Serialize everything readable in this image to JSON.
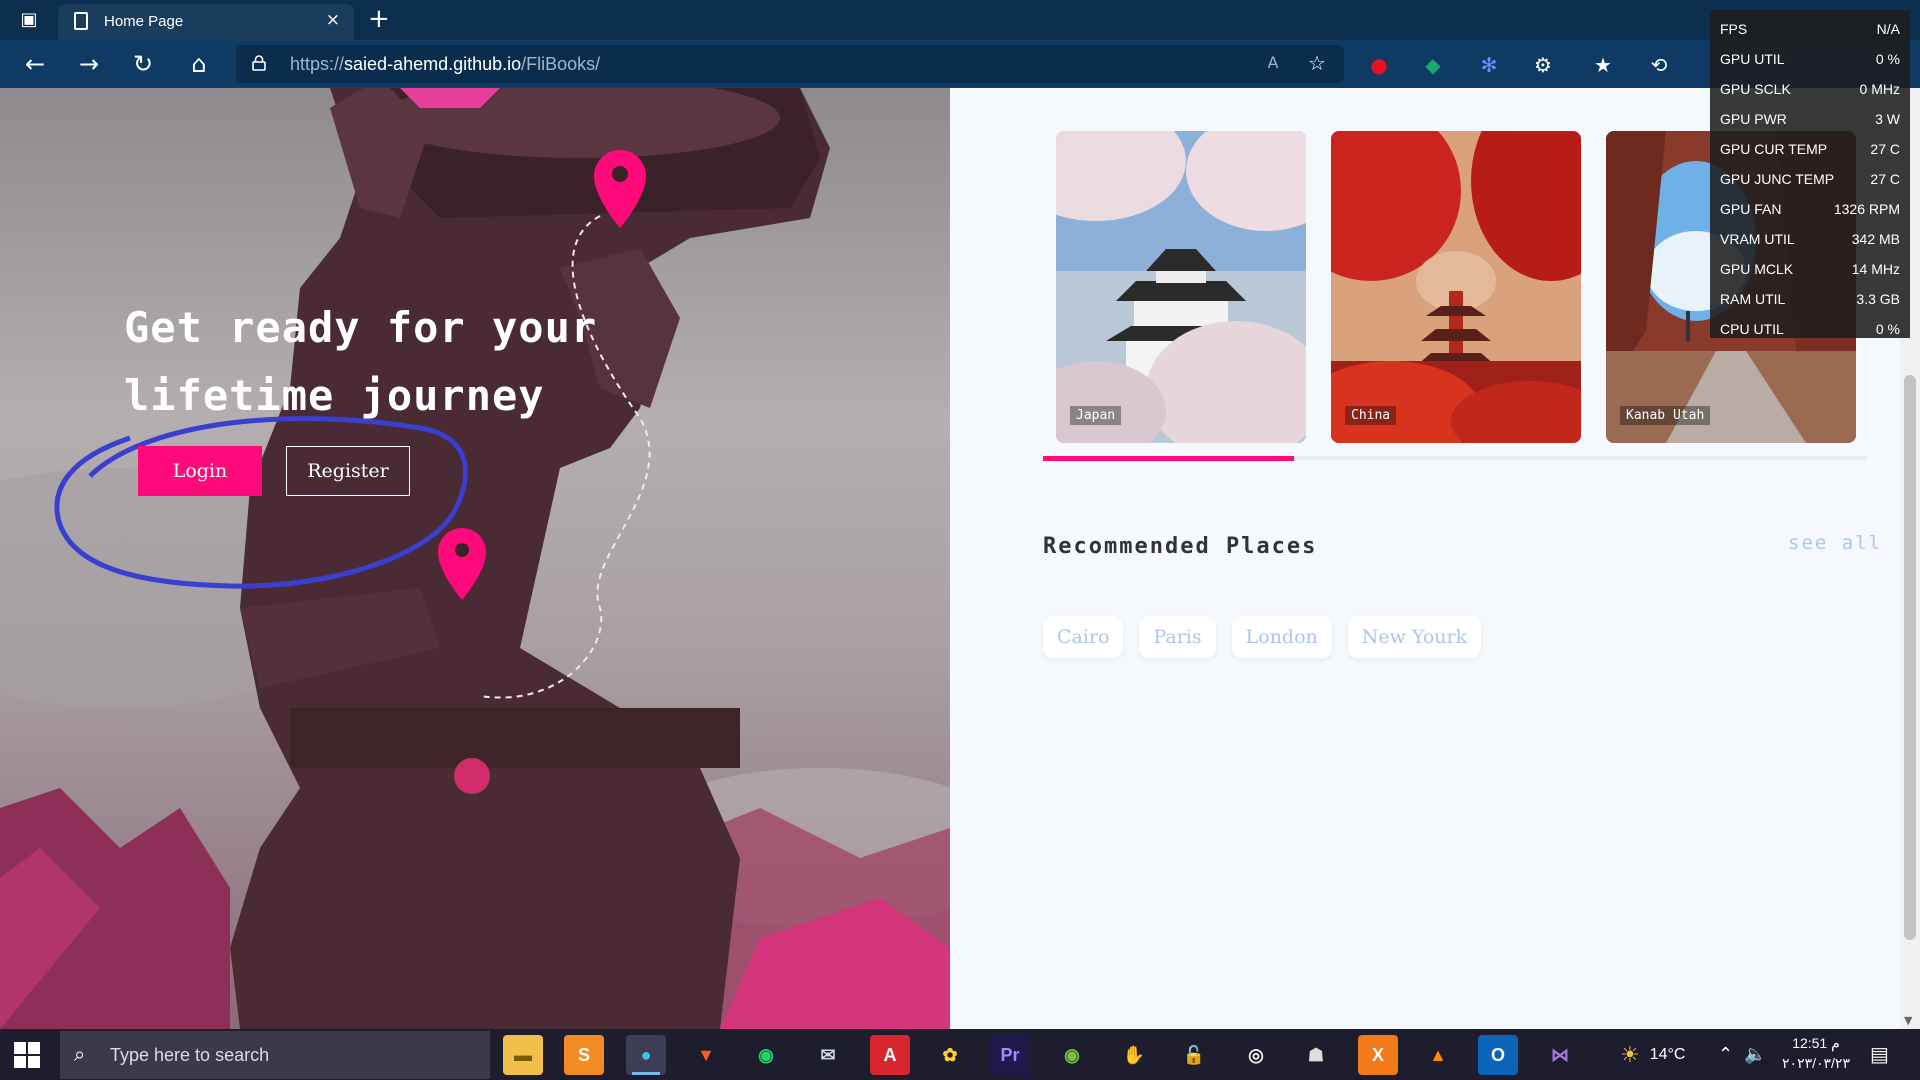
{
  "browser": {
    "tab_title": "Home Page",
    "close_tab": "×",
    "new_tab": "+",
    "url_prefix": "https://",
    "url_host": "saied-ahemd.github.io",
    "url_path": "/FliBooks/"
  },
  "gpu_overlay": {
    "rows": [
      {
        "label": "FPS",
        "value": "N/A"
      },
      {
        "label": "GPU UTIL",
        "value": "0 %"
      },
      {
        "label": "GPU SCLK",
        "value": "0 MHz"
      },
      {
        "label": "GPU PWR",
        "value": "3 W"
      },
      {
        "label": "GPU CUR TEMP",
        "value": "27 C"
      },
      {
        "label": "GPU JUNC TEMP",
        "value": "27 C"
      },
      {
        "label": "GPU FAN",
        "value": "1326 RPM"
      },
      {
        "label": "VRAM UTIL",
        "value": "342 MB"
      },
      {
        "label": "GPU MCLK",
        "value": "14 MHz"
      },
      {
        "label": "RAM UTIL",
        "value": "3.3 GB"
      },
      {
        "label": "CPU UTIL",
        "value": "0 %"
      }
    ]
  },
  "hero": {
    "title": "Get ready for your lifetime journey",
    "login_label": "Login",
    "register_label": "Register"
  },
  "destinations": {
    "cards": [
      {
        "label": "Japan"
      },
      {
        "label": "China"
      },
      {
        "label": "Kanab Utah"
      }
    ],
    "progress_fraction": 0.305
  },
  "recommended": {
    "title": "Recommended Places",
    "see_all": "see all",
    "chips": [
      "Cairo",
      "Paris",
      "London",
      "New Yourk"
    ]
  },
  "taskbar": {
    "search_placeholder": "Type here to search",
    "weather": "14°C",
    "time": "12:51 م",
    "date": "٢٠٢٣/٠٣/٢٣"
  },
  "colors": {
    "accent": "#ff0a7a",
    "chrome_dark": "#0d2f4f",
    "chip_text": "#a9c6ee",
    "annotation_circle": "#3b3fd0"
  }
}
